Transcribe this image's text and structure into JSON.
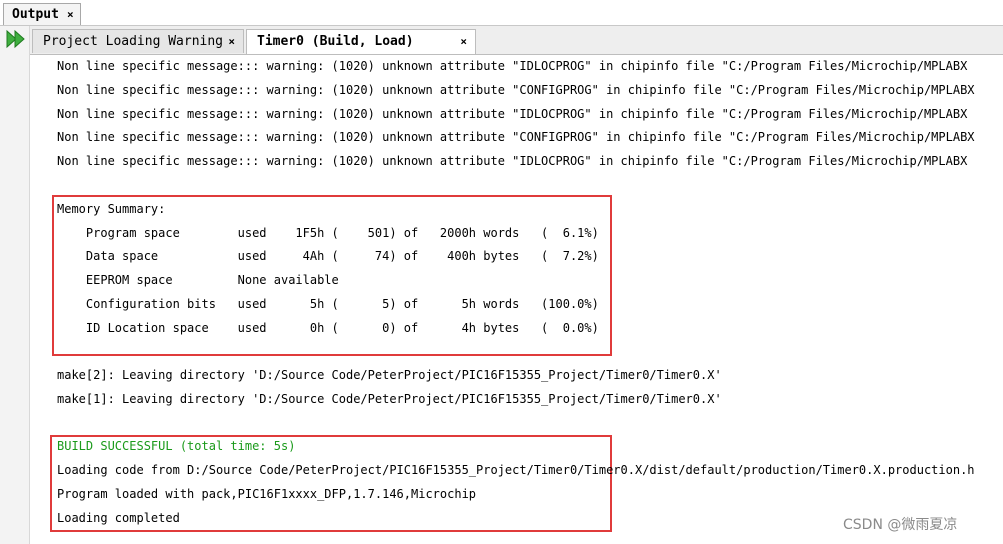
{
  "output_tab": {
    "label": "Output",
    "close": "×"
  },
  "tabs": [
    {
      "label": "Project Loading Warning",
      "close": "×"
    },
    {
      "label": "Timer0 (Build, Load)",
      "close": "×"
    }
  ],
  "lines": {
    "w1": "Non line specific message::: warning: (1020) unknown attribute \"IDLOCPROG\" in chipinfo file \"C:/Program Files/Microchip/MPLABX",
    "w2": "Non line specific message::: warning: (1020) unknown attribute \"CONFIGPROG\" in chipinfo file \"C:/Program Files/Microchip/MPLABX",
    "w3": "Non line specific message::: warning: (1020) unknown attribute \"IDLOCPROG\" in chipinfo file \"C:/Program Files/Microchip/MPLABX",
    "w4": "Non line specific message::: warning: (1020) unknown attribute \"CONFIGPROG\" in chipinfo file \"C:/Program Files/Microchip/MPLABX",
    "w5": "Non line specific message::: warning: (1020) unknown attribute \"IDLOCPROG\" in chipinfo file \"C:/Program Files/Microchip/MPLABX",
    "mem_title": "Memory Summary:",
    "mem1": "    Program space        used    1F5h (    501) of   2000h words   (  6.1%)",
    "mem2": "    Data space           used     4Ah (     74) of    400h bytes   (  7.2%)",
    "mem3": "    EEPROM space         None available",
    "mem4": "    Configuration bits   used      5h (      5) of      5h words   (100.0%)",
    "mem5": "    ID Location space    used      0h (      0) of      4h bytes   (  0.0%)",
    "make2": "make[2]: Leaving directory 'D:/Source Code/PeterProject/PIC16F15355_Project/Timer0/Timer0.X'",
    "make1": "make[1]: Leaving directory 'D:/Source Code/PeterProject/PIC16F15355_Project/Timer0/Timer0.X'",
    "build": "BUILD SUCCESSFUL (total time: 5s)",
    "load": "Loading code from D:/Source Code/PeterProject/PIC16F15355_Project/Timer0/Timer0.X/dist/default/production/Timer0.X.production.h",
    "pack": "Program loaded with pack,PIC16F1xxxx_DFP,1.7.146,Microchip",
    "done": "Loading completed"
  },
  "watermark": "CSDN @微雨夏凉",
  "colors": {
    "highlight_box": "#e03b3b",
    "success_text": "#1a9a1a"
  }
}
